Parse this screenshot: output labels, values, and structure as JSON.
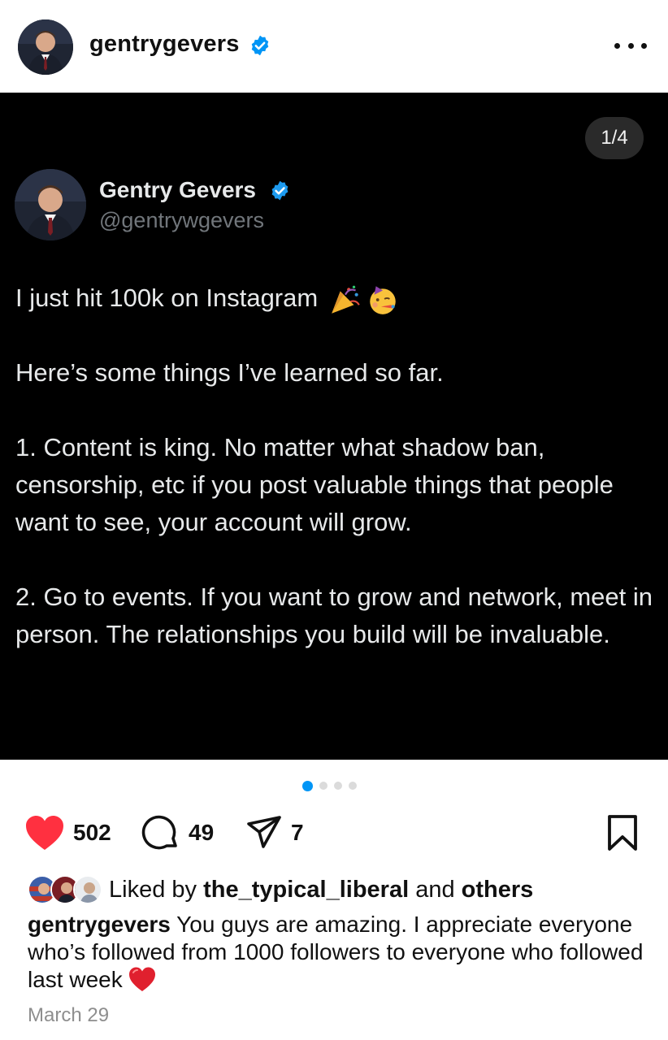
{
  "header": {
    "username": "gentrygevers",
    "verified": true,
    "more_icon": "more-horizontal-icon"
  },
  "media": {
    "counter": "1/4",
    "tweet": {
      "display_name": "Gentry Gevers",
      "handle": "@gentrywgevers",
      "verified": true,
      "lines": [
        "I just hit 100k on Instagram",
        "Here’s some things I’ve learned so far.",
        "1. Content is king. No matter what shadow ban, censorship, etc if you post valuable things that people want to see, your account will grow.",
        "2. Go to events. If you want to grow and network, meet in person. The relationships you build will be invaluable."
      ],
      "emojis": [
        "party-popper-icon",
        "partying-face-icon"
      ]
    }
  },
  "carousel": {
    "total": 4,
    "active_index": 0
  },
  "actions": {
    "likes": "502",
    "comments": "49",
    "shares": "7"
  },
  "liked_by": {
    "prefix": "Liked by ",
    "user": "the_typical_liberal",
    "middle": " and ",
    "suffix": "others"
  },
  "caption": {
    "username": "gentrygevers",
    "text": "You guys are amazing. I appreciate everyone who’s followed from 1000 followers to everyone who followed last week"
  },
  "date": "March 29",
  "colors": {
    "accent": "#0095f6",
    "like_red": "#ff3040",
    "verified_blue": "#1d9bf0",
    "tweet_bg": "#000000"
  }
}
